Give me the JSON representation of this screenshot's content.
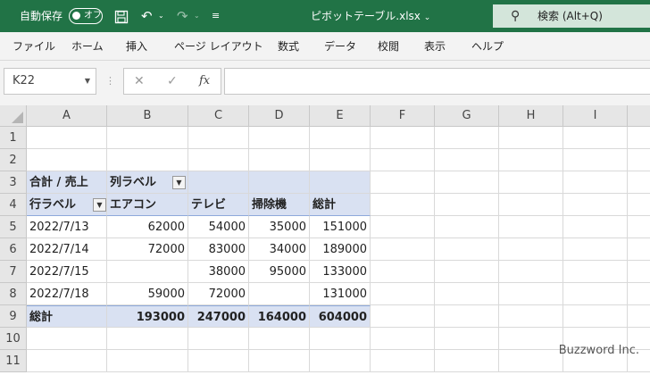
{
  "titlebar": {
    "autosave_label": "自動保存",
    "autosave_state": "オフ",
    "filename": "ピボットテーブル.xlsx",
    "search_label": "検索 (Alt+Q)"
  },
  "menu": [
    "ファイル",
    "ホーム",
    "挿入",
    "ページ レイアウト",
    "数式",
    "データ",
    "校閲",
    "表示",
    "ヘルプ"
  ],
  "formula_bar": {
    "name_box": "K22",
    "formula": ""
  },
  "grid": {
    "columns": [
      "A",
      "B",
      "C",
      "D",
      "E",
      "F",
      "G",
      "H",
      "I"
    ],
    "rows": [
      "1",
      "2",
      "3",
      "4",
      "5",
      "6",
      "7",
      "8",
      "9",
      "10",
      "11"
    ],
    "pivot": {
      "row3": {
        "a": "合計 / 売上",
        "b": "列ラベル"
      },
      "row4": {
        "a": "行ラベル",
        "b": "エアコン",
        "c": "テレビ",
        "d": "掃除機",
        "e": "総計"
      },
      "data": [
        {
          "a": "2022/7/13",
          "b": "62000",
          "c": "54000",
          "d": "35000",
          "e": "151000"
        },
        {
          "a": "2022/7/14",
          "b": "72000",
          "c": "83000",
          "d": "34000",
          "e": "189000"
        },
        {
          "a": "2022/7/15",
          "b": "",
          "c": "38000",
          "d": "95000",
          "e": "133000"
        },
        {
          "a": "2022/7/18",
          "b": "59000",
          "c": "72000",
          "d": "",
          "e": "131000"
        }
      ],
      "total": {
        "a": "総計",
        "b": "193000",
        "c": "247000",
        "d": "164000",
        "e": "604000"
      }
    }
  },
  "watermark": "Buzzword Inc.",
  "colors": {
    "excel_green": "#217346",
    "pivot_band": "#d9e1f2"
  }
}
